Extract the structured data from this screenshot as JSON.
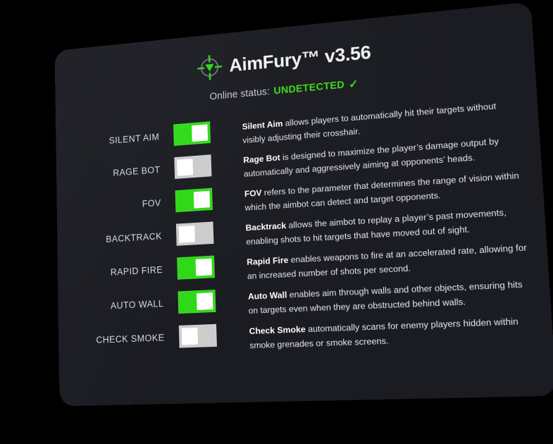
{
  "app": {
    "title": "AimFury™ v3.56",
    "logo_icon": "crosshair-target-icon",
    "accent_green": "#2fd916",
    "panel_bg": "#1b1c22",
    "toggle_off_color": "#cccccc",
    "toggle_knob_color": "#ffffff"
  },
  "status": {
    "label": "Online status:",
    "value": "UNDETECTED",
    "check_icon": "✓"
  },
  "features": [
    {
      "label": "SILENT AIM",
      "name": "Silent Aim",
      "state": "on",
      "desc_bold": "Silent Aim",
      "desc_rest": " allows players to automatically hit their targets without visibly adjusting their crosshair."
    },
    {
      "label": "RAGE BOT",
      "name": "Rage Bot",
      "state": "off",
      "desc_bold": "Rage Bot",
      "desc_rest": " is designed to maximize the player’s damage output by automatically and aggressively aiming at opponents’ heads."
    },
    {
      "label": "FOV",
      "name": "FOV",
      "state": "on",
      "desc_bold": "FOV",
      "desc_rest": " refers to the parameter that determines the range of vision within which the aimbot can detect and target opponents."
    },
    {
      "label": "BACKTRACK",
      "name": "Backtrack",
      "state": "off",
      "desc_bold": "Backtrack",
      "desc_rest": " allows the aimbot to replay a player’s past movements, enabling shots to hit targets that have moved out of sight."
    },
    {
      "label": "RAPID FIRE",
      "name": "Rapid Fire",
      "state": "on",
      "desc_bold": "Rapid Fire",
      "desc_rest": " enables weapons to fire at an accelerated rate, allowing for an increased number of shots per second."
    },
    {
      "label": "AUTO WALL",
      "name": "Auto Wall",
      "state": "on",
      "desc_bold": "Auto Wall",
      "desc_rest": " enables aim through walls and other objects, ensuring hits on targets even when they are obstructed behind walls."
    },
    {
      "label": "CHECK SMOKE",
      "name": "Check Smoke",
      "state": "off",
      "desc_bold": "Check Smoke",
      "desc_rest": " automatically scans for enemy players hidden within smoke grenades or smoke screens."
    }
  ]
}
